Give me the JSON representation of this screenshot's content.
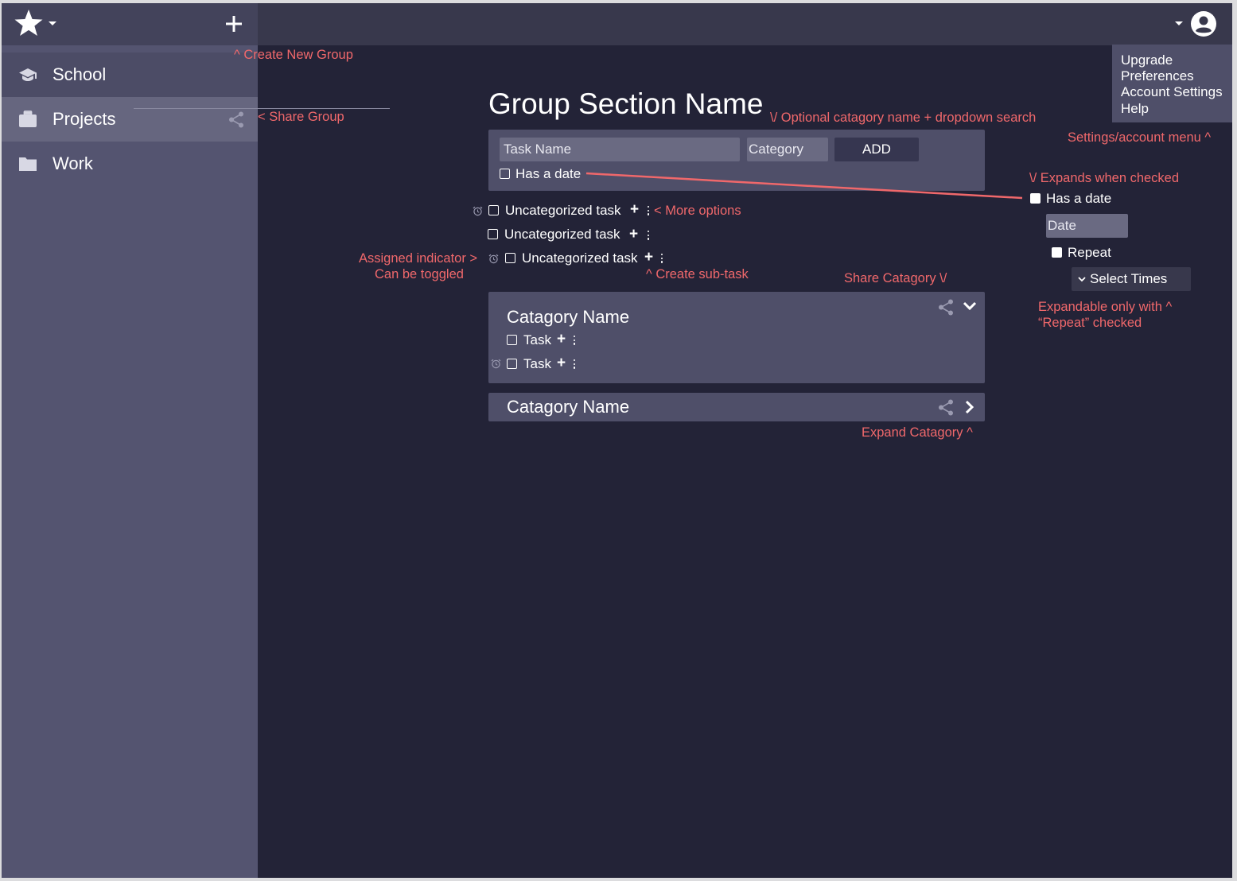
{
  "sidebar": {
    "items": [
      {
        "label": "School",
        "icon": "school-icon"
      },
      {
        "label": "Projects",
        "icon": "briefcase-icon"
      },
      {
        "label": "Work",
        "icon": "folder-icon"
      }
    ]
  },
  "topbar": {
    "logo_icon": "star-icon",
    "add_icon": "plus-icon",
    "account_icon": "account-circle-icon"
  },
  "main": {
    "group_title": "Group Section Name",
    "add_form": {
      "task_placeholder": "Task Name",
      "category_placeholder": "Category",
      "add_label": "ADD",
      "has_date_label": "Has a date"
    },
    "tasks": [
      {
        "label": "Uncategorized task",
        "assigned": true
      },
      {
        "label": "Uncategorized task",
        "assigned": false
      },
      {
        "label": "Uncategorized task",
        "assigned": true
      }
    ],
    "categories": [
      {
        "title": "Catagory Name",
        "expanded": true,
        "tasks": [
          {
            "label": "Task",
            "assigned": false
          },
          {
            "label": "Task",
            "assigned": true
          }
        ]
      },
      {
        "title": "Catagory Name",
        "expanded": false,
        "tasks": []
      }
    ]
  },
  "settings_menu": {
    "items": [
      "Upgrade",
      "Preferences",
      "Account Settings",
      "Help"
    ]
  },
  "date_panel": {
    "has_date_label": "Has a date",
    "date_placeholder": "Date",
    "repeat_label": "Repeat",
    "select_times_label": "Select Times"
  },
  "annotations": {
    "create_group": "^ Create New Group",
    "share_group": "< Share Group",
    "optional_category": "\\/ Optional catagory name + dropdown search",
    "settings_menu": "Settings/account menu ^",
    "expands_when_checked": "\\/ Expands when checked",
    "more_options": "< More options",
    "assigned_indicator": "Assigned indicator >",
    "can_be_toggled": "Can be toggled",
    "create_subtask": "^ Create sub-task",
    "share_category": "Share Catagory \\/",
    "expandable_line1": "Expandable only with ^",
    "expandable_line2": "“Repeat” checked",
    "expand_category": "Expand Catagory ^"
  },
  "colors": {
    "background": "#232337",
    "topbar": "#38384c",
    "sidebar": "#545470",
    "panel": "#4f4f69",
    "input": "#6a6a82",
    "annotation": "#f0686b"
  }
}
